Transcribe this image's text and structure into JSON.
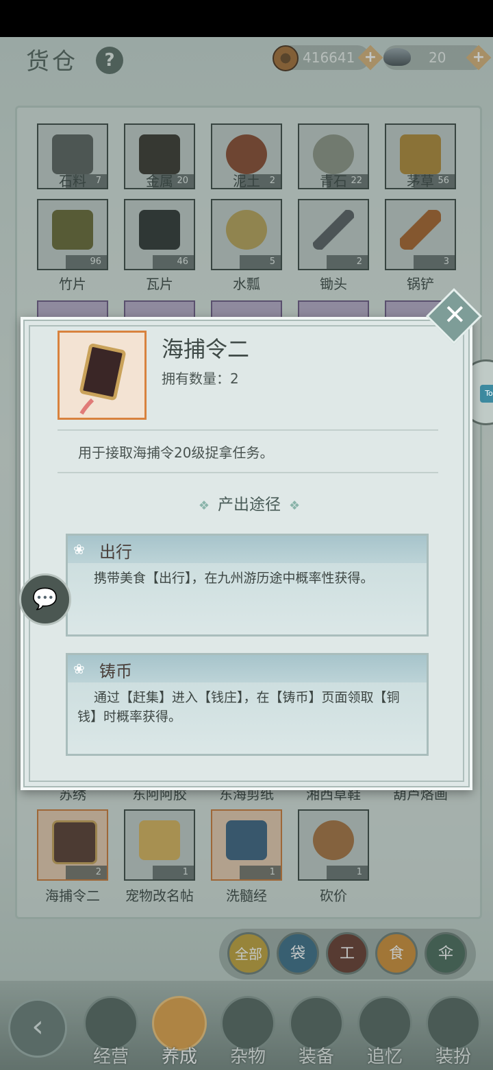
{
  "header": {
    "title": "货仓",
    "help_icon": "?",
    "coins": "416641",
    "ingots": "20",
    "plus": "+"
  },
  "grid_rows": [
    [
      {
        "label": "石料",
        "count": "7"
      },
      {
        "label": "金属",
        "count": "20"
      },
      {
        "label": "泥土",
        "count": "2"
      },
      {
        "label": "青石",
        "count": "22"
      },
      {
        "label": "茅草",
        "count": "56"
      }
    ],
    [
      {
        "label": "竹片",
        "count": "96"
      },
      {
        "label": "瓦片",
        "count": "46"
      },
      {
        "label": "水瓢",
        "count": "5"
      },
      {
        "label": "锄头",
        "count": "2"
      },
      {
        "label": "锅铲",
        "count": "3"
      }
    ],
    [
      {
        "label": "苏绣",
        "count": ""
      },
      {
        "label": "东阿阿胶",
        "count": ""
      },
      {
        "label": "东海剪纸",
        "count": ""
      },
      {
        "label": "湘西草鞋",
        "count": ""
      },
      {
        "label": "葫芦烙画",
        "count": ""
      }
    ],
    [
      {
        "label": "海捕令二",
        "count": "2"
      },
      {
        "label": "宠物改名帖",
        "count": "1"
      },
      {
        "label": "洗髓经",
        "count": "1"
      },
      {
        "label": "砍价",
        "count": "1"
      }
    ]
  ],
  "dialog": {
    "item_name": "海捕令二",
    "owned_label": "拥有数量：2",
    "description": "用于接取海捕令20级捉拿任务。",
    "sources_title": "产出途径",
    "sources": [
      {
        "title": "出行",
        "text": "携带美食【出行】，在九州游历途中概率性获得。"
      },
      {
        "title": "铸币",
        "text": "通过【赶集】进入【钱庄】，在【铸币】页面领取【铜钱】时概率获得。"
      }
    ],
    "close": "✕"
  },
  "side_button_text": "To",
  "filters": [
    "全部",
    "袋",
    "工",
    "食",
    "伞"
  ],
  "bottom_nav": [
    {
      "label": "经营",
      "active": false
    },
    {
      "label": "养成",
      "active": true
    },
    {
      "label": "杂物",
      "active": false
    },
    {
      "label": "装备",
      "active": false
    },
    {
      "label": "追忆",
      "active": false
    },
    {
      "label": "装扮",
      "active": false
    }
  ],
  "back_icon": "‹",
  "colors": {
    "accent": "#d8823e",
    "panel": "#dfe8e7",
    "active_tab": "#e2a24b"
  }
}
